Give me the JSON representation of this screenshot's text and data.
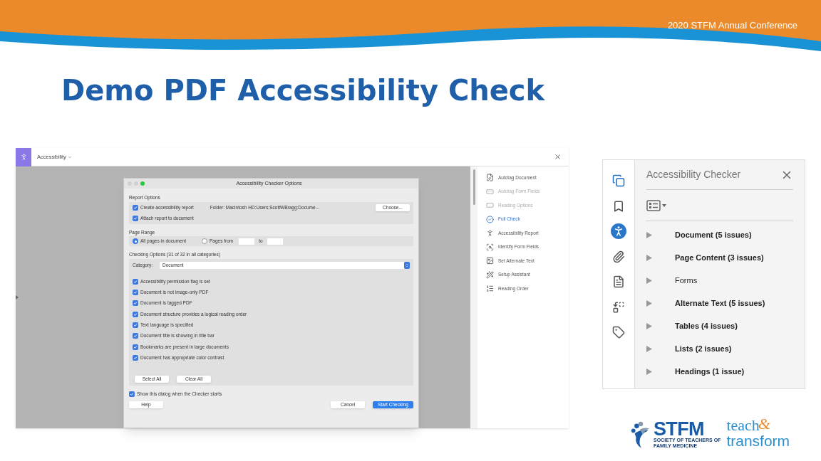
{
  "header": {
    "conference": "2020 STFM Annual Conference"
  },
  "title": "Demo PDF Accessibility Check",
  "app": {
    "menu": "Accessibility",
    "dialog": {
      "title": "Accessibility Checker Options",
      "report_options": {
        "heading": "Report Options",
        "create": {
          "label": "Create accessibility report",
          "checked": true
        },
        "folder": "Folder: Macintosh HD:Users:ScottWBragg:Docume...",
        "choose": "Choose...",
        "attach": {
          "label": "Attach report to document",
          "checked": true
        }
      },
      "page_range": {
        "heading": "Page Range",
        "options": [
          {
            "label": "All pages in document",
            "selected": true
          },
          {
            "label": "Pages from",
            "selected": false
          }
        ],
        "to": "to"
      },
      "checking": {
        "heading": "Checking Options (31 of 32 in all categories)",
        "category_label": "Category:",
        "category": "Document",
        "items": [
          {
            "label": "Accessibility permission flag is set",
            "checked": true
          },
          {
            "label": "Document is not image-only PDF",
            "checked": true
          },
          {
            "label": "Document is tagged PDF",
            "checked": true
          },
          {
            "label": "Document structure provides a logical reading order",
            "checked": true
          },
          {
            "label": "Text language is specified",
            "checked": true
          },
          {
            "label": "Document title is showing in title bar",
            "checked": true
          },
          {
            "label": "Bookmarks are present in large documents",
            "checked": true
          },
          {
            "label": "Document has appropriate color contrast",
            "checked": true
          }
        ],
        "select_all": "Select All",
        "clear_all": "Clear All"
      },
      "show_dialog": {
        "label": "Show this dialog when the Checker starts",
        "checked": true
      },
      "buttons": [
        {
          "label": "Help",
          "kind": "normal"
        },
        {
          "label": "Cancel",
          "kind": "normal"
        },
        {
          "label": "Start Checking",
          "kind": "primary"
        }
      ]
    },
    "tools": [
      {
        "label": "Autotag Document",
        "kind": "autotag",
        "selected": false,
        "disabled": false
      },
      {
        "label": "Autotag Form Fields",
        "kind": "form",
        "selected": false,
        "disabled": true
      },
      {
        "label": "Reading Options",
        "kind": "options",
        "selected": false,
        "disabled": true
      },
      {
        "label": "Full Check",
        "kind": "check",
        "selected": true,
        "disabled": false
      },
      {
        "label": "Accessibility Report",
        "kind": "report",
        "selected": false,
        "disabled": false
      },
      {
        "label": "Identify Form Fields",
        "kind": "identify",
        "selected": false,
        "disabled": false
      },
      {
        "label": "Set Alternate Text",
        "kind": "alt",
        "selected": false,
        "disabled": false
      },
      {
        "label": "Setup Assistant",
        "kind": "wand",
        "selected": false,
        "disabled": false
      },
      {
        "label": "Reading Order",
        "kind": "order",
        "selected": false,
        "disabled": false
      }
    ]
  },
  "checker_panel": {
    "title": "Accessibility Checker",
    "side_tools": [
      {
        "kind": "pages",
        "selected": false
      },
      {
        "kind": "bookmark",
        "selected": false
      },
      {
        "kind": "accessibility",
        "selected": true
      },
      {
        "kind": "clip",
        "selected": false
      },
      {
        "kind": "document",
        "selected": false
      },
      {
        "kind": "compare",
        "selected": false
      },
      {
        "kind": "tag",
        "selected": false
      }
    ],
    "items": [
      {
        "label": "Document (5 issues)",
        "has_issues": true
      },
      {
        "label": "Page Content (3 issues)",
        "has_issues": true
      },
      {
        "label": "Forms",
        "has_issues": false
      },
      {
        "label": "Alternate Text (5 issues)",
        "has_issues": true
      },
      {
        "label": "Tables (4 issues)",
        "has_issues": true
      },
      {
        "label": "Lists (2 issues)",
        "has_issues": true
      },
      {
        "label": "Headings (1 issue)",
        "has_issues": true
      }
    ]
  },
  "logo": {
    "name": "STFM",
    "tagline": [
      "SOCIETY OF TEACHERS OF",
      "FAMILY MEDICINE"
    ],
    "teach": "teach",
    "ampersand": "&",
    "transform": "transform"
  }
}
